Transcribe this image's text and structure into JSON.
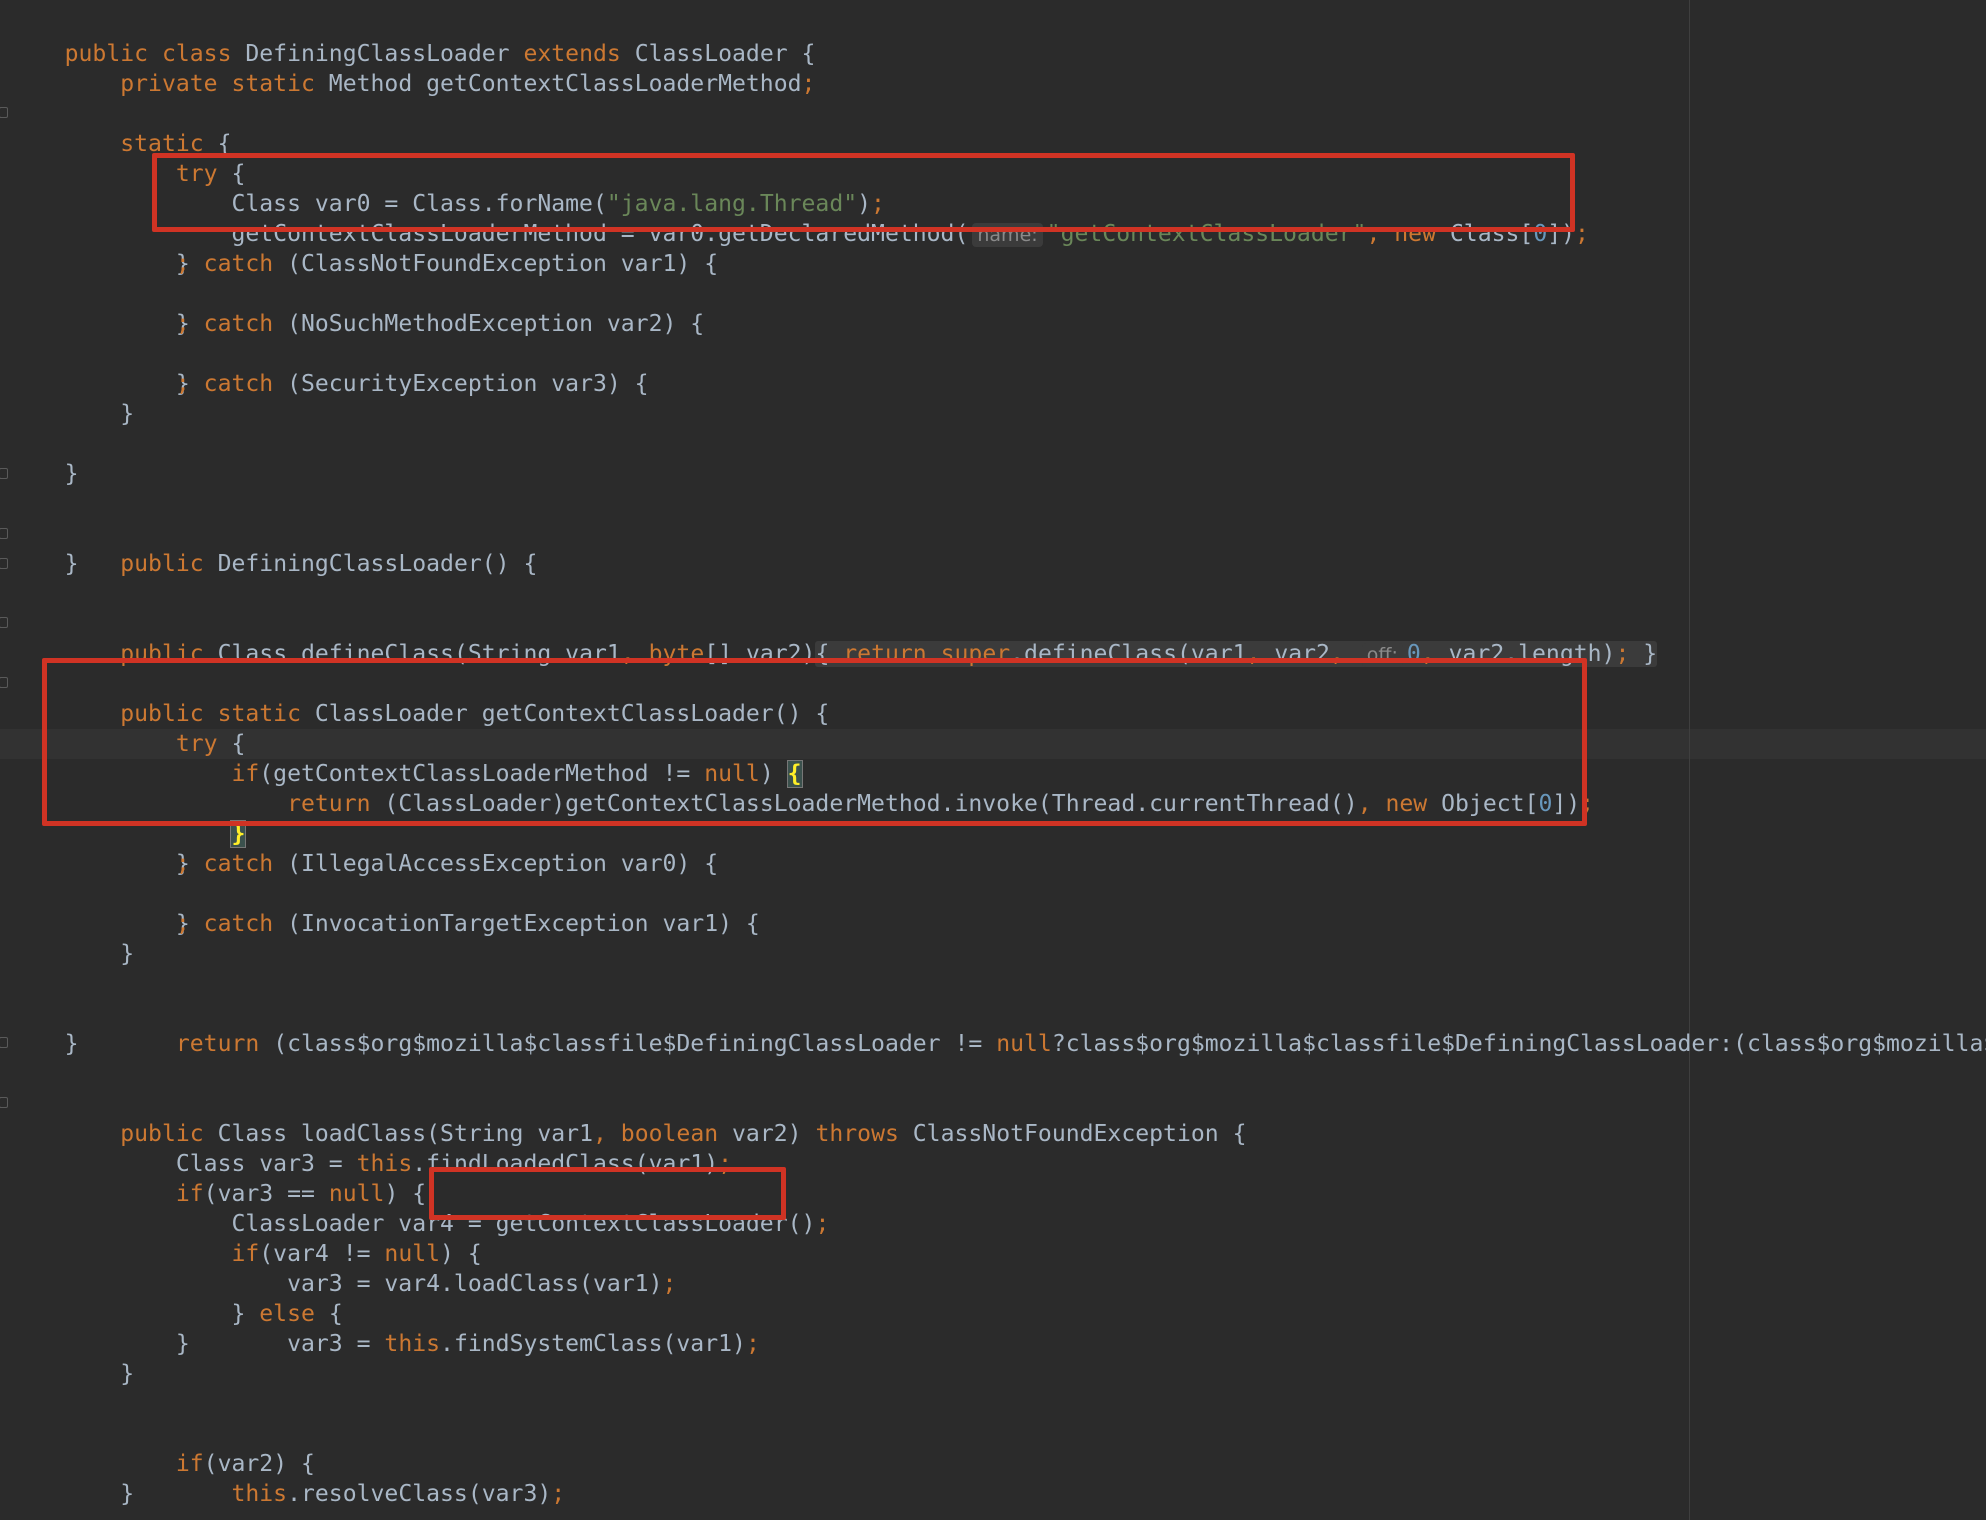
{
  "editor": {
    "language": "Java",
    "theme": "Darcula",
    "colors": {
      "background": "#2b2b2b",
      "keyword": "#cc7832",
      "string": "#6a8759",
      "number": "#6897bb",
      "plain": "#a9b7c6",
      "highlight_box": "#d03324"
    }
  },
  "code": {
    "l01": [
      "public class ",
      "DefiningClassLoader ",
      "extends ",
      "ClassLoader {"
    ],
    "l02": [
      "    private static ",
      "Method getContextClassLoaderMethod",
      ";"
    ],
    "l04": [
      "    static ",
      "{"
    ],
    "l05": [
      "        try ",
      "{"
    ],
    "l06": [
      "            Class var0 = Class.forName(",
      "\"java.lang.Thread\"",
      ")",
      ";"
    ],
    "l07": [
      "            getContextClassLoaderMethod = var0.getDeclaredMethod(",
      "name:",
      "\"getContextClassLoader\"",
      ", ",
      "new ",
      "Class[",
      "0",
      "])",
      ";"
    ],
    "l08": [
      "        } ",
      "catch ",
      "(ClassNotFoundException var1) {"
    ],
    "l09": [
      "            ;"
    ],
    "l10": [
      "        } ",
      "catch ",
      "(NoSuchMethodException var2) {"
    ],
    "l11": [
      "            ;"
    ],
    "l12": [
      "        } ",
      "catch ",
      "(SecurityException var3) {"
    ],
    "l13": [
      "            ;"
    ],
    "l14": [
      "        }"
    ],
    "l16": [
      "    }"
    ],
    "l18": [
      "    public ",
      "DefiningClassLoader() {"
    ],
    "l19": [
      "    }"
    ],
    "l21": [
      "    public ",
      "Class defineClass(String var1",
      ", ",
      "byte",
      "[] var2)",
      "{ ",
      "return ",
      "super",
      ".defineClass(var1",
      ", ",
      "var2",
      ", ",
      "off:",
      "0",
      ", ",
      "var2.length)",
      ";",
      " }"
    ],
    "l23": [
      "    public static ",
      "ClassLoader getContextClassLoader() {"
    ],
    "l24": [
      "        try ",
      "{"
    ],
    "l25": [
      "            ",
      "if",
      "(getContextClassLoaderMethod != ",
      "null",
      ") ",
      "{"
    ],
    "l26": [
      "                ",
      "return ",
      "(ClassLoader)getContextClassLoaderMethod.invoke(Thread.currentThread()",
      ", ",
      "new ",
      "Object[",
      "0",
      "])",
      ";"
    ],
    "l27": [
      "            ",
      "}"
    ],
    "l28": [
      "        } ",
      "catch ",
      "(IllegalAccessException var0) {"
    ],
    "l29": [
      "            ;"
    ],
    "l30": [
      "        } ",
      "catch ",
      "(InvocationTargetException var1) {"
    ],
    "l31": [
      "            ;"
    ],
    "l32": [
      "        }"
    ],
    "l34": [
      "        ",
      "return ",
      "(class$org$mozilla$classfile$DefiningClassLoader != ",
      "null",
      "?class$org$mozilla$classfile$DefiningClassLoader:(class$org$mozilla$classfile$DefiningClassLoader"
    ],
    "l35": [
      "    }"
    ],
    "l37": [
      "    public ",
      "Class loadClass(String var1",
      ", ",
      "boolean ",
      "var2) ",
      "throws ",
      "ClassNotFoundException {"
    ],
    "l38": [
      "        Class var3 = ",
      "this",
      ".findLoadedClass(var1)",
      ";"
    ],
    "l39": [
      "        ",
      "if",
      "(var3 == ",
      "null",
      ") {"
    ],
    "l40": [
      "            ClassLoader var4 = ",
      "getContextClassLoader()",
      ";"
    ],
    "l41": [
      "            ",
      "if",
      "(var4 != ",
      "null",
      ") {"
    ],
    "l42": [
      "                var3 = var4.loadClass(var1)",
      ";"
    ],
    "l43": [
      "            } ",
      "else ",
      "{"
    ],
    "l44": [
      "                var3 = ",
      "this",
      ".findSystemClass(var1)",
      ";"
    ],
    "l45": [
      "            }"
    ],
    "l46": [
      "        }"
    ],
    "l48": [
      "        ",
      "if",
      "(var2) {"
    ],
    "l49": [
      "            ",
      "this",
      ".resolveClass(var3)",
      ";"
    ],
    "l50": [
      "        }"
    ]
  }
}
